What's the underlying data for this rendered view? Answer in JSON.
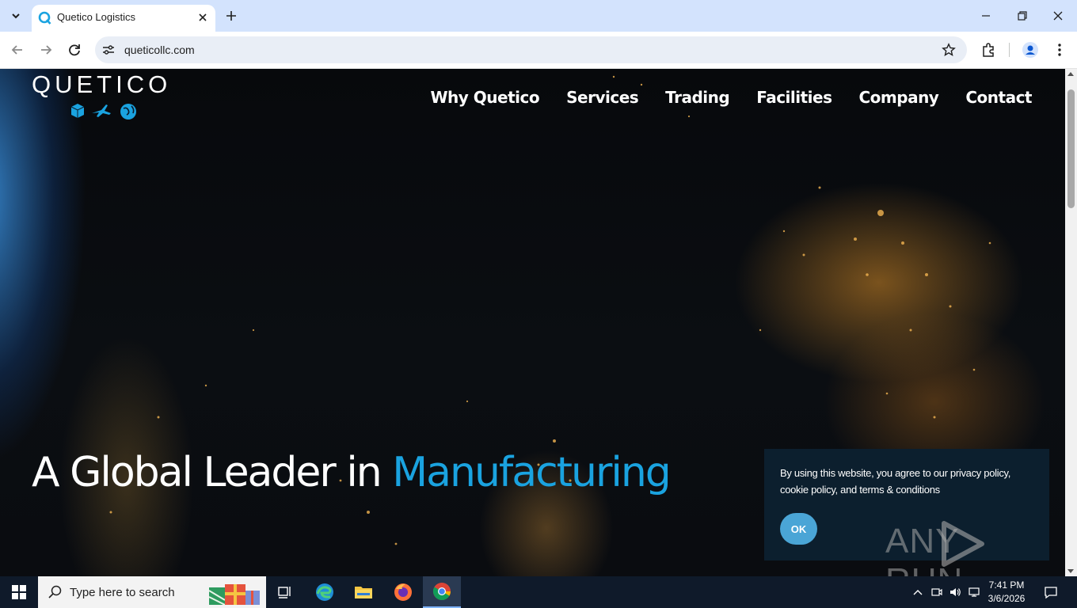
{
  "browser": {
    "tab_title": "Quetico Logistics",
    "url": "queticollc.com"
  },
  "site": {
    "logo_text": "QUETICO",
    "nav": [
      "Why Quetico",
      "Services",
      "Trading",
      "Facilities",
      "Company",
      "Contact"
    ],
    "hero_prefix": "A Global Leader in",
    "hero_accent": "Manufacturing",
    "accent_color": "#1aa3e0"
  },
  "cookie_banner": {
    "message": "By using this website, you agree to our privacy policy, cookie policy, and terms & conditions",
    "ok_label": "OK"
  },
  "watermark": {
    "text_left": "ANY",
    "text_right": "RUN"
  },
  "taskbar": {
    "search_placeholder": "Type here to search",
    "time": "7:41 PM",
    "date": "3/6/2026"
  }
}
